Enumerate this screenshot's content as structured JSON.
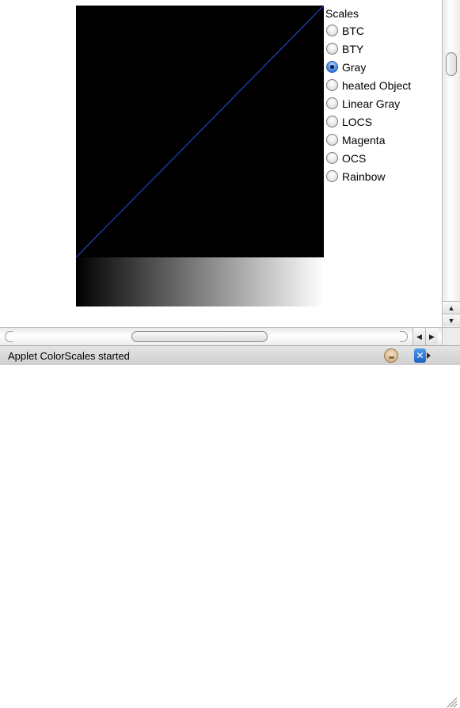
{
  "scales": {
    "title": "Scales",
    "options": [
      {
        "label": "BTC",
        "checked": false
      },
      {
        "label": "BTY",
        "checked": false
      },
      {
        "label": "Gray",
        "checked": true
      },
      {
        "label": "heated Object",
        "checked": false
      },
      {
        "label": "Linear Gray",
        "checked": false
      },
      {
        "label": "LOCS",
        "checked": false
      },
      {
        "label": "Magenta",
        "checked": false
      },
      {
        "label": "OCS",
        "checked": false
      },
      {
        "label": "Rainbow",
        "checked": false
      }
    ]
  },
  "plot": {
    "background_color": "#000000",
    "line_color": "#1f3fbf"
  },
  "gradient": {
    "start_color": "#000000",
    "end_color": "#ffffff"
  },
  "status": {
    "text": "Applet ColorScales started"
  },
  "scrollbars": {
    "vertical": {
      "up_glyph": "▲",
      "down_glyph": "▼"
    },
    "horizontal": {
      "left_glyph": "◀",
      "right_glyph": "▶"
    }
  }
}
